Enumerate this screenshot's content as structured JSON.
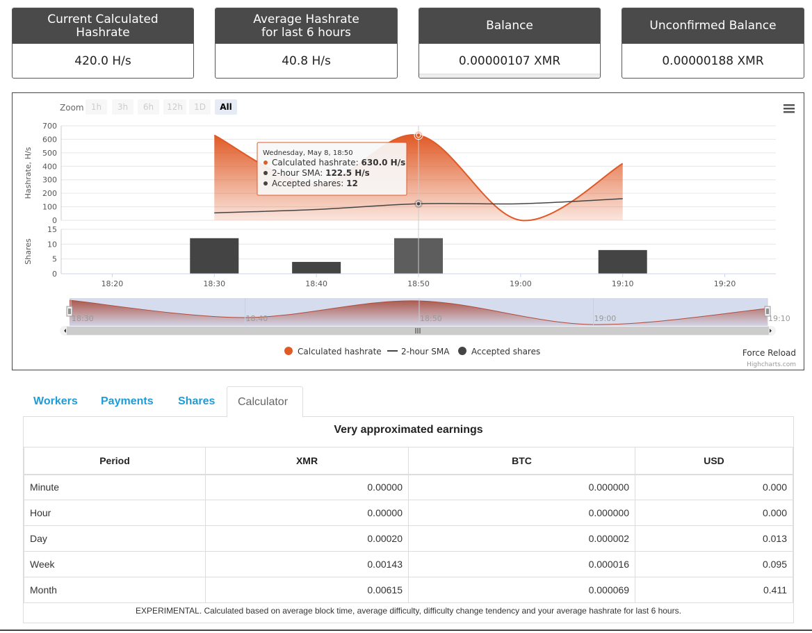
{
  "stats": [
    {
      "title": "Current Calculated\nHashrate",
      "value": "420.0 H/s"
    },
    {
      "title": "Average Hashrate\nfor last 6 hours",
      "value": "40.8 H/s"
    },
    {
      "title": "Balance",
      "value": "0.00000107 XMR"
    },
    {
      "title": "Unconfirmed Balance",
      "value": "0.00000188 XMR"
    }
  ],
  "zoom": {
    "label": "Zoom",
    "buttons": [
      "1h",
      "3h",
      "6h",
      "12h",
      "1D",
      "All"
    ],
    "active": "All"
  },
  "tooltip": {
    "date": "Wednesday, May 8, 18:50",
    "rows": [
      {
        "label": "Calculated hashrate: ",
        "value": "630.0 H/s",
        "color": "#e05a26"
      },
      {
        "label": "2-hour SMA: ",
        "value": "122.5 H/s",
        "color": "#444444"
      },
      {
        "label": "Accepted shares: ",
        "value": "12",
        "color": "#444444"
      }
    ]
  },
  "chart_data": {
    "type": "line",
    "title": "",
    "colors": {
      "hashrate": "#e05a26",
      "sma": "#444444",
      "shares": "#444444"
    },
    "hashrate_panel": {
      "ylabel": "Hashrate, H/s",
      "ylim": [
        0,
        700
      ],
      "yticks": [
        0,
        100,
        200,
        300,
        400,
        500,
        600,
        700
      ]
    },
    "shares_panel": {
      "ylabel": "Shares",
      "ylim": [
        0,
        15
      ],
      "yticks": [
        0,
        5,
        10,
        15
      ]
    },
    "xticks": [
      "18:20",
      "18:30",
      "18:40",
      "18:50",
      "19:00",
      "19:10",
      "19:20"
    ],
    "series": [
      {
        "name": "Calculated hashrate",
        "type": "area",
        "x": [
          "18:30",
          "18:50",
          "19:00",
          "19:10"
        ],
        "values": [
          630,
          630,
          0,
          420
        ]
      },
      {
        "name": "2-hour SMA",
        "type": "line",
        "x": [
          "18:30",
          "18:40",
          "18:50",
          "19:00",
          "19:10"
        ],
        "values": [
          55,
          80,
          122.5,
          122.5,
          160
        ]
      },
      {
        "name": "Accepted shares",
        "type": "bar",
        "x": [
          "18:30",
          "18:40",
          "18:50",
          "19:10"
        ],
        "values": [
          12,
          4,
          12,
          8
        ]
      }
    ],
    "navigator_labels": [
      "18:30",
      "18:40",
      "18:50",
      "19:00",
      "19:10"
    ],
    "legend": "bottom-center"
  },
  "force_reload": "Force Reload",
  "credits": "Highcharts.com",
  "tabs": [
    {
      "label": "Workers"
    },
    {
      "label": "Payments"
    },
    {
      "label": "Shares"
    },
    {
      "label": "Calculator"
    }
  ],
  "calculator": {
    "title": "Very approximated earnings",
    "columns": [
      "Period",
      "XMR",
      "BTC",
      "USD"
    ],
    "rows": [
      [
        "Minute",
        "0.00000",
        "0.000000",
        "0.000"
      ],
      [
        "Hour",
        "0.00000",
        "0.000000",
        "0.000"
      ],
      [
        "Day",
        "0.00020",
        "0.000002",
        "0.013"
      ],
      [
        "Week",
        "0.00143",
        "0.000016",
        "0.095"
      ],
      [
        "Month",
        "0.00615",
        "0.000069",
        "0.411"
      ]
    ],
    "note": "EXPERIMENTAL. Calculated based on average block time, average difficulty, difficulty change tendency and your average hashrate for last 6 hours."
  }
}
